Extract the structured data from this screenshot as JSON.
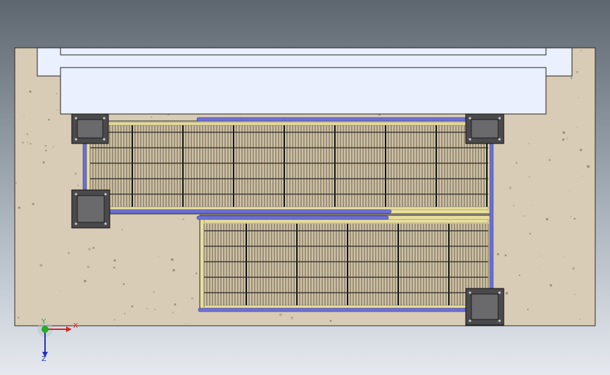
{
  "viewport": {
    "background_top": "#5e6670",
    "background_mid": "#a8b0ba",
    "background_bottom": "#e6eaef"
  },
  "model": {
    "concrete_color": "#d8ccb6",
    "wall_color": "#eaf0fd",
    "frame_color": "#e9df9c",
    "grating_line_color": "#3a3630",
    "rail_color": "#6c70d4",
    "plate_color": "#4a4a4c"
  },
  "triad": {
    "x_label": "X",
    "y_label": "Y",
    "z_label": "Z",
    "x_color": "#e02020",
    "y_color": "#20b020",
    "z_color": "#2030c0"
  }
}
